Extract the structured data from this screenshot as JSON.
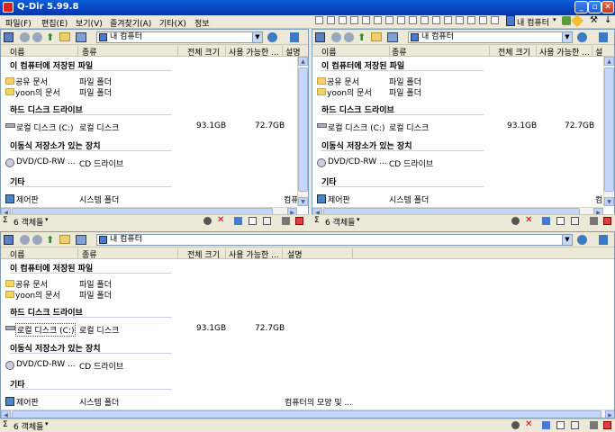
{
  "window": {
    "title": "Q-Dir 5.99.8"
  },
  "menu": [
    "파일(F)",
    "편집(E)",
    "보기(V)",
    "즐겨찾기(A)",
    "기타(X)",
    "정보"
  ],
  "toolbar_right": {
    "computer_label": "내 컴퓨터"
  },
  "colors": {
    "title_bar": "#0846c2",
    "group_header": "#000000",
    "pane_border": "#7f9db9",
    "close_button": "#c2391c"
  },
  "panes": [
    {
      "address": "내 컴퓨터",
      "columns": [
        "이름",
        "종류",
        "전체 크기",
        "사용 가능한 ...",
        "설명"
      ],
      "groups": [
        {
          "title": "이 컴퓨터에 저장된 파일",
          "items": [
            {
              "name": "공유 문서",
              "type": "파일 폴더",
              "total": "",
              "free": "",
              "desc": ""
            },
            {
              "name": "yoon의 문서",
              "type": "파일 폴더",
              "total": "",
              "free": "",
              "desc": ""
            }
          ]
        },
        {
          "title": "하드 디스크 드라이브",
          "items": [
            {
              "name": "로컬 디스크 (C:)",
              "type": "로컬 디스크",
              "total": "93.1GB",
              "free": "72.7GB",
              "desc": ""
            }
          ]
        },
        {
          "title": "이동식 저장소가 있는 장치",
          "items": [
            {
              "name": "DVD/CD-RW ...",
              "type": "CD 드라이브",
              "total": "",
              "free": "",
              "desc": ""
            }
          ]
        },
        {
          "title": "기타",
          "items": [
            {
              "name": "제어판",
              "type": "시스템 폴더",
              "total": "",
              "free": "",
              "desc": "컴퓨"
            }
          ]
        }
      ],
      "status": "6 객체들"
    },
    {
      "address": "내 컴퓨터",
      "columns": [
        "이름",
        "종류",
        "전체 크기",
        "사용 가능한 ...",
        "설"
      ],
      "groups": [
        {
          "title": "이 컴퓨터에 저장된 파일",
          "items": [
            {
              "name": "공유 문서",
              "type": "파일 폴더",
              "total": "",
              "free": "",
              "desc": ""
            },
            {
              "name": "yoon의 문서",
              "type": "파일 폴더",
              "total": "",
              "free": "",
              "desc": ""
            }
          ]
        },
        {
          "title": "하드 디스크 드라이브",
          "items": [
            {
              "name": "로컬 디스크 (C:)",
              "type": "로컬 디스크",
              "total": "93.1GB",
              "free": "72.7GB",
              "desc": ""
            }
          ]
        },
        {
          "title": "이동식 저장소가 있는 장치",
          "items": [
            {
              "name": "DVD/CD-RW ...",
              "type": "CD 드라이브",
              "total": "",
              "free": "",
              "desc": ""
            }
          ]
        },
        {
          "title": "기타",
          "items": [
            {
              "name": "제어판",
              "type": "시스템 폴더",
              "total": "",
              "free": "",
              "desc": "컴"
            }
          ]
        }
      ],
      "status": "6 객체들"
    },
    {
      "address": "내 컴퓨터",
      "columns": [
        "이름",
        "종류",
        "전체 크기",
        "사용 가능한 ...",
        "설명"
      ],
      "groups": [
        {
          "title": "이 컴퓨터에 저장된 파일",
          "items": [
            {
              "name": "공유 문서",
              "type": "파일 폴더",
              "total": "",
              "free": "",
              "desc": ""
            },
            {
              "name": "yoon의 문서",
              "type": "파일 폴더",
              "total": "",
              "free": "",
              "desc": ""
            }
          ]
        },
        {
          "title": "하드 디스크 드라이브",
          "items": [
            {
              "name": "로컬 디스크 (C:)",
              "type": "로컬 디스크",
              "total": "93.1GB",
              "free": "72.7GB",
              "desc": ""
            }
          ]
        },
        {
          "title": "이동식 저장소가 있는 장치",
          "items": [
            {
              "name": "DVD/CD-RW ...",
              "type": "CD 드라이브",
              "total": "",
              "free": "",
              "desc": ""
            }
          ]
        },
        {
          "title": "기타",
          "items": [
            {
              "name": "제어판",
              "type": "시스템 폴더",
              "total": "",
              "free": "",
              "desc": "컴퓨터의 모양 및 ..."
            }
          ]
        }
      ],
      "status": "6 객체들"
    }
  ]
}
